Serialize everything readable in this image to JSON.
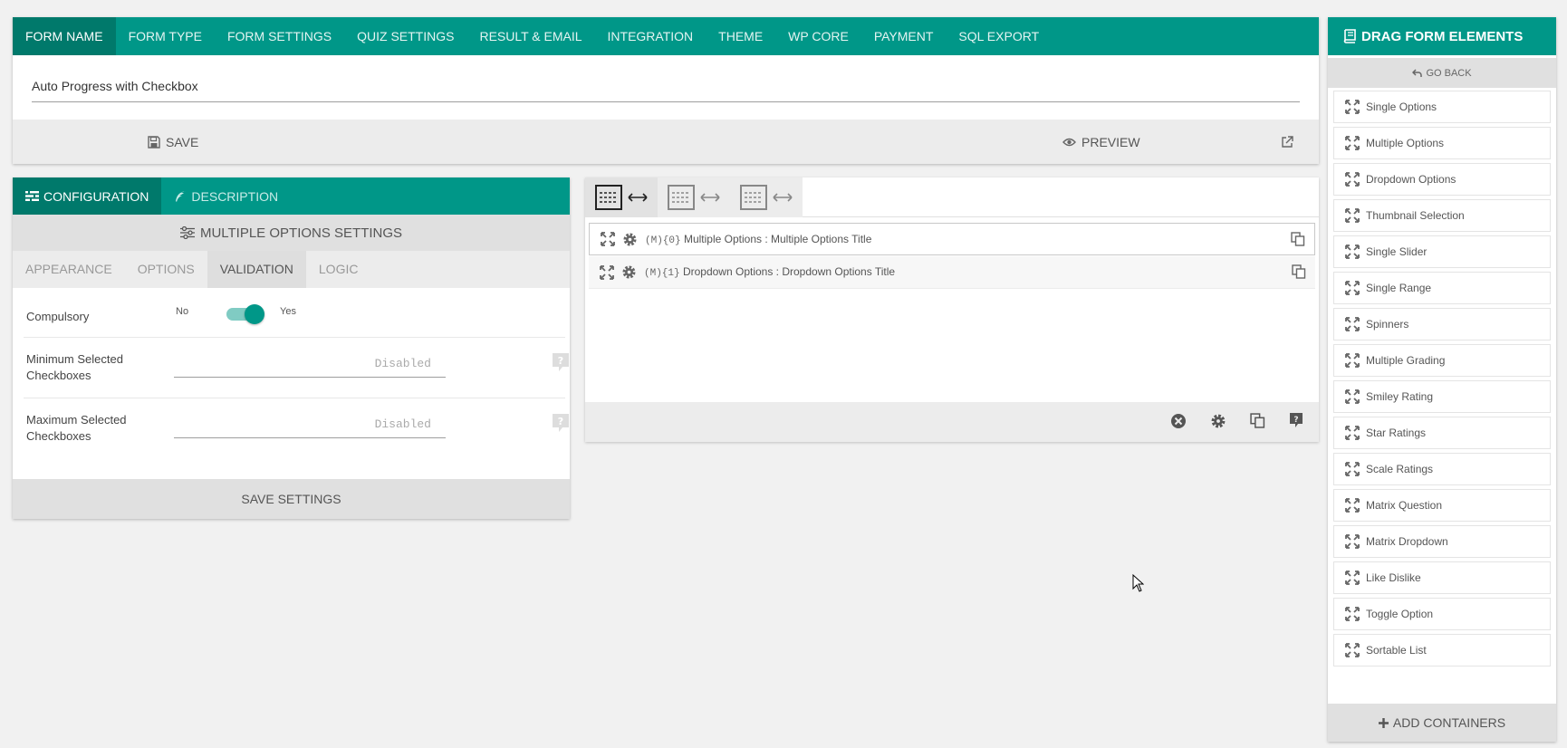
{
  "top_tabs": [
    "FORM NAME",
    "FORM TYPE",
    "FORM SETTINGS",
    "QUIZ SETTINGS",
    "RESULT & EMAIL",
    "INTEGRATION",
    "THEME",
    "WP CORE",
    "PAYMENT",
    "SQL EXPORT"
  ],
  "form": {
    "name": "Auto Progress with Checkbox"
  },
  "actions": {
    "save": "SAVE",
    "preview": "PREVIEW"
  },
  "config": {
    "tab_configuration": "CONFIGURATION",
    "tab_description": "DESCRIPTION",
    "settings_title": "MULTIPLE OPTIONS SETTINGS",
    "sub_tabs": [
      "APPEARANCE",
      "OPTIONS",
      "VALIDATION",
      "LOGIC"
    ],
    "compulsory": {
      "label": "Compulsory",
      "no": "No",
      "yes": "Yes",
      "value": true
    },
    "min_selected": {
      "label": "Minimum Selected Checkboxes",
      "placeholder": "Disabled"
    },
    "max_selected": {
      "label": "Maximum Selected Checkboxes",
      "placeholder": "Disabled"
    },
    "save_settings": "SAVE SETTINGS"
  },
  "builder": {
    "items": [
      {
        "code": "(M){0}",
        "text": "Multiple Options : Multiple Options Title"
      },
      {
        "code": "(M){1}",
        "text": "Dropdown Options : Dropdown Options Title"
      }
    ]
  },
  "sidebar": {
    "title": "DRAG FORM ELEMENTS",
    "go_back": "GO BACK",
    "elements": [
      "Single Options",
      "Multiple Options",
      "Dropdown Options",
      "Thumbnail Selection",
      "Single Slider",
      "Single Range",
      "Spinners",
      "Multiple Grading",
      "Smiley Rating",
      "Star Ratings",
      "Scale Ratings",
      "Matrix Question",
      "Matrix Dropdown",
      "Like Dislike",
      "Toggle Option",
      "Sortable List"
    ],
    "add_containers": "ADD CONTAINERS"
  },
  "colors": {
    "accent": "#009788",
    "accent_dark": "#00796b"
  }
}
